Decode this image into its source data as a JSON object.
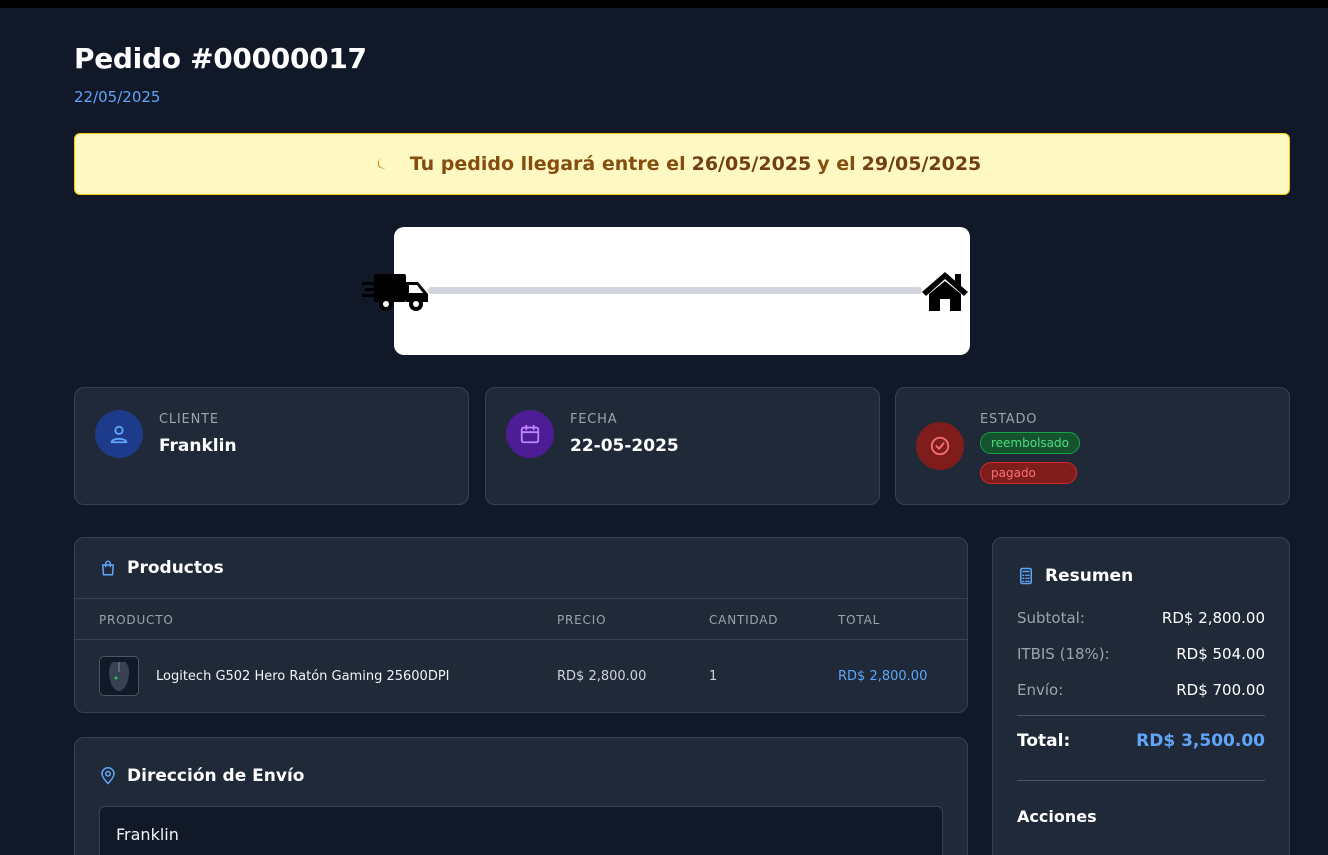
{
  "order": {
    "title": "Pedido #00000017",
    "date": "22/05/2025"
  },
  "delivery_banner": {
    "icon": "moon-icon",
    "text_prefix": "Tu pedido llegará entre el",
    "start_date": "26/05/2025",
    "middle": "y el",
    "end_date": "29/05/2025"
  },
  "tracker": {
    "start_icon": "truck-icon",
    "end_icon": "house-icon",
    "progress": 0
  },
  "info_cards": {
    "client": {
      "label": "CLIENTE",
      "value": "Franklin",
      "icon": "user-icon"
    },
    "date": {
      "label": "FECHA",
      "value": "22-05-2025",
      "icon": "calendar-icon"
    },
    "status": {
      "label": "ESTADO",
      "badges": [
        "reembolsado",
        "pagado"
      ],
      "icon": "check-circle-icon"
    }
  },
  "products": {
    "title": "Productos",
    "icon": "shopping-bag-icon",
    "columns": [
      "PRODUCTO",
      "PRECIO",
      "CANTIDAD",
      "TOTAL"
    ],
    "rows": [
      {
        "name": "Logitech G502 Hero Ratón Gaming 25600DPI",
        "price": "RD$ 2,800.00",
        "quantity": "1",
        "total": "RD$ 2,800.00"
      }
    ]
  },
  "address": {
    "title": "Dirección de Envío",
    "icon": "map-pin-icon",
    "name": "Franklin"
  },
  "summary": {
    "title": "Resumen",
    "icon": "calculator-icon",
    "subtotal_label": "Subtotal:",
    "subtotal": "RD$ 2,800.00",
    "tax_label": "ITBIS (18%):",
    "tax": "RD$ 504.00",
    "shipping_label": "Envío:",
    "shipping": "RD$ 700.00",
    "total_label": "Total:",
    "total": "RD$ 3,500.00",
    "actions_title": "Acciones"
  },
  "colors": {
    "background": "#111827",
    "card": "#1f2937",
    "accent_blue": "#60a5fa",
    "banner_bg": "#fef9c3",
    "success": "#4ade80",
    "danger": "#f87171"
  }
}
